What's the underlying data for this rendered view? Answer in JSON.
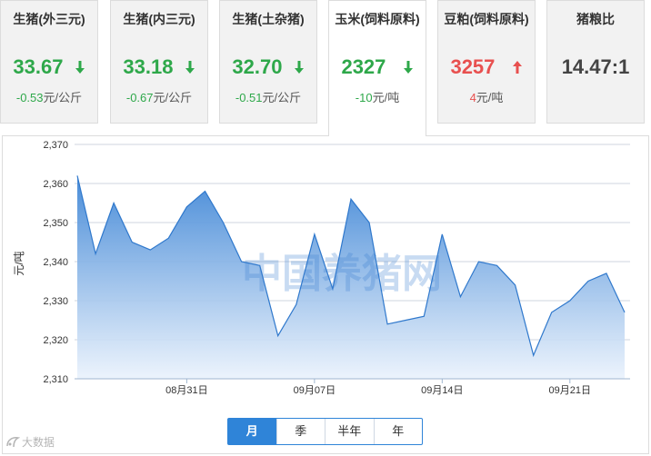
{
  "cards": [
    {
      "title": "生猪(外三元)",
      "value": "33.67",
      "change_num": "-0.53",
      "change_unit": "元/公斤",
      "trend": "down",
      "arrow_icon": "arrow-down-icon"
    },
    {
      "title": "生猪(内三元)",
      "value": "33.18",
      "change_num": "-0.67",
      "change_unit": "元/公斤",
      "trend": "down",
      "arrow_icon": "arrow-down-icon"
    },
    {
      "title": "生猪(土杂猪)",
      "value": "32.70",
      "change_num": "-0.51",
      "change_unit": "元/公斤",
      "trend": "down",
      "arrow_icon": "arrow-down-icon"
    },
    {
      "title": "玉米(饲料原料)",
      "value": "2327",
      "change_num": "-10",
      "change_unit": "元/吨",
      "trend": "down",
      "arrow_icon": "arrow-down-icon"
    },
    {
      "title": "豆粕(饲料原料)",
      "value": "3257",
      "change_num": "4",
      "change_unit": "元/吨",
      "trend": "up",
      "arrow_icon": "arrow-up-icon"
    },
    {
      "title": "猪粮比",
      "value": "14.47:1",
      "trend": "neutral"
    }
  ],
  "tabs": [
    "月",
    "季",
    "半年",
    "年"
  ],
  "brand": "大数据",
  "watermark": "中国养猪网",
  "colors": {
    "up": "#e8504f",
    "down": "#2ea84a",
    "accent": "#2f84d8",
    "area_top": "#3f86d6",
    "area_bottom": "#eaf2fc"
  },
  "chart_data": {
    "type": "area",
    "ylabel": "元/吨",
    "ylim": [
      2310,
      2370
    ],
    "yticks": [
      2310,
      2320,
      2330,
      2340,
      2350,
      2360,
      2370
    ],
    "ytick_labels": [
      "2,310",
      "2,320",
      "2,330",
      "2,340",
      "2,350",
      "2,360",
      "2,370"
    ],
    "x_start": "08-25",
    "xtick_labels": [
      {
        "day": 6,
        "label": "08月31日"
      },
      {
        "day": 13,
        "label": "09月07日"
      },
      {
        "day": 20,
        "label": "09月14日"
      },
      {
        "day": 27,
        "label": "09月21日"
      }
    ],
    "grid": true,
    "legend": "none",
    "x": [
      "08-25",
      "08-26",
      "08-27",
      "08-28",
      "08-29",
      "08-30",
      "08-31",
      "09-01",
      "09-02",
      "09-03",
      "09-04",
      "09-05",
      "09-06",
      "09-07",
      "09-08",
      "09-09",
      "09-10",
      "09-11",
      "09-12",
      "09-13",
      "09-14",
      "09-15",
      "09-16",
      "09-17",
      "09-18",
      "09-19",
      "09-20",
      "09-21",
      "09-22",
      "09-23",
      "09-24"
    ],
    "series": [
      {
        "values": [
          2362,
          2342,
          2355,
          2345,
          2343,
          2346,
          2354,
          2358,
          2350,
          2340,
          2339,
          2321,
          2329,
          2347,
          2333,
          2356,
          2350,
          2324,
          2325,
          2326,
          2347,
          2331,
          2340,
          2339,
          2334,
          2316,
          2327,
          2330,
          2335,
          2337,
          2327
        ]
      }
    ]
  }
}
